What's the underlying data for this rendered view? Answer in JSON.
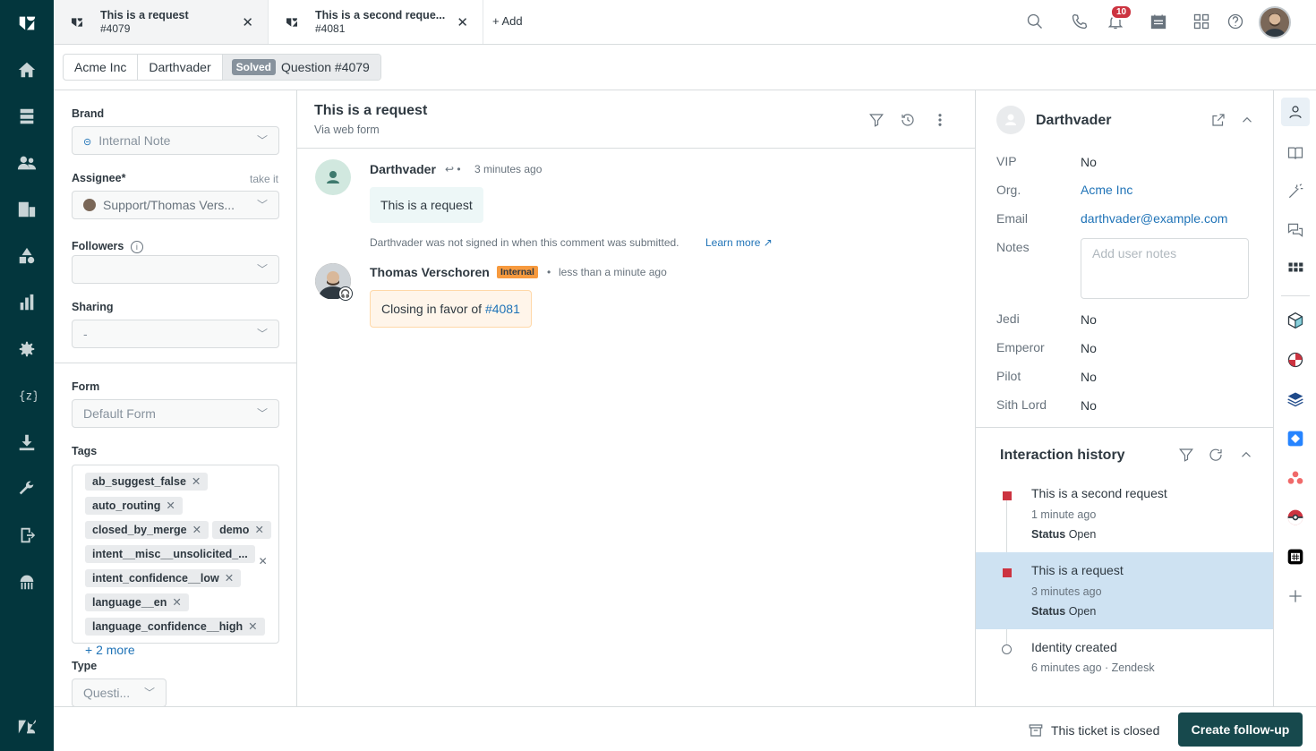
{
  "tabs": [
    {
      "title": "This is a request",
      "sub": "#4079"
    },
    {
      "title": "This is a second reque...",
      "sub": "#4081"
    }
  ],
  "topbar": {
    "add_label": "+ Add",
    "notif_count": "10"
  },
  "breadcrumb": {
    "org": "Acme Inc",
    "user": "Darthvader",
    "status": "Solved",
    "ticket": "Question #4079"
  },
  "left": {
    "brand_label": "Brand",
    "brand_value": "Internal Note",
    "assignee_label": "Assignee*",
    "assignee_hint": "take it",
    "assignee_value": "Support/Thomas Vers...",
    "followers_label": "Followers",
    "sharing_label": "Sharing",
    "sharing_value": "-",
    "form_label": "Form",
    "form_value": "Default Form",
    "tags_label": "Tags",
    "tags": [
      "ab_suggest_false",
      "auto_routing",
      "closed_by_merge",
      "demo",
      "intent__misc__unsolicited_...",
      "intent_confidence__low",
      "language__en",
      "language_confidence__high"
    ],
    "more_tags": "+ 2 more",
    "type_label": "Type",
    "type_value": "Questi..."
  },
  "conversation": {
    "title": "This is a request",
    "via": "Via web form",
    "c1_name": "Darthvader",
    "c1_time": "3 minutes ago",
    "c1_body": "This is a request",
    "c1_notice": "Darthvader was not signed in when this comment was submitted.",
    "c1_learn": "Learn more",
    "c2_name": "Thomas Verschoren",
    "c2_badge": "Internal",
    "c2_time": "less than a minute ago",
    "c2_body": "Closing in favor of ",
    "c2_link": "#4081"
  },
  "user": {
    "name": "Darthvader",
    "fields": [
      {
        "label": "VIP",
        "value": "No"
      },
      {
        "label": "Org.",
        "value": "Acme Inc"
      },
      {
        "label": "Email",
        "value": "darthvader@example.com"
      },
      {
        "label": "Notes",
        "value": ""
      },
      {
        "label": "Jedi",
        "value": "No"
      },
      {
        "label": "Emperor",
        "value": "No"
      },
      {
        "label": "Pilot",
        "value": "No"
      },
      {
        "label": "Sith Lord",
        "value": "No"
      }
    ],
    "notes_placeholder": "Add user notes"
  },
  "history": {
    "title": "Interaction history",
    "items": [
      {
        "title": "This is a second request",
        "time": "1 minute ago",
        "status_label": "Status",
        "status": "Open"
      },
      {
        "title": "This is a request",
        "time": "3 minutes ago",
        "status_label": "Status",
        "status": "Open"
      },
      {
        "title": "Identity created",
        "time": "6 minutes ago · Zendesk"
      }
    ]
  },
  "footer": {
    "closed": "This ticket is closed",
    "followup": "Create follow-up"
  },
  "colors": {
    "nav": "#03363d",
    "primary": "#17494d",
    "link": "#1f73b7",
    "internal": "#f79a3e",
    "selected": "#cee2f2",
    "alert": "#cc3340"
  }
}
